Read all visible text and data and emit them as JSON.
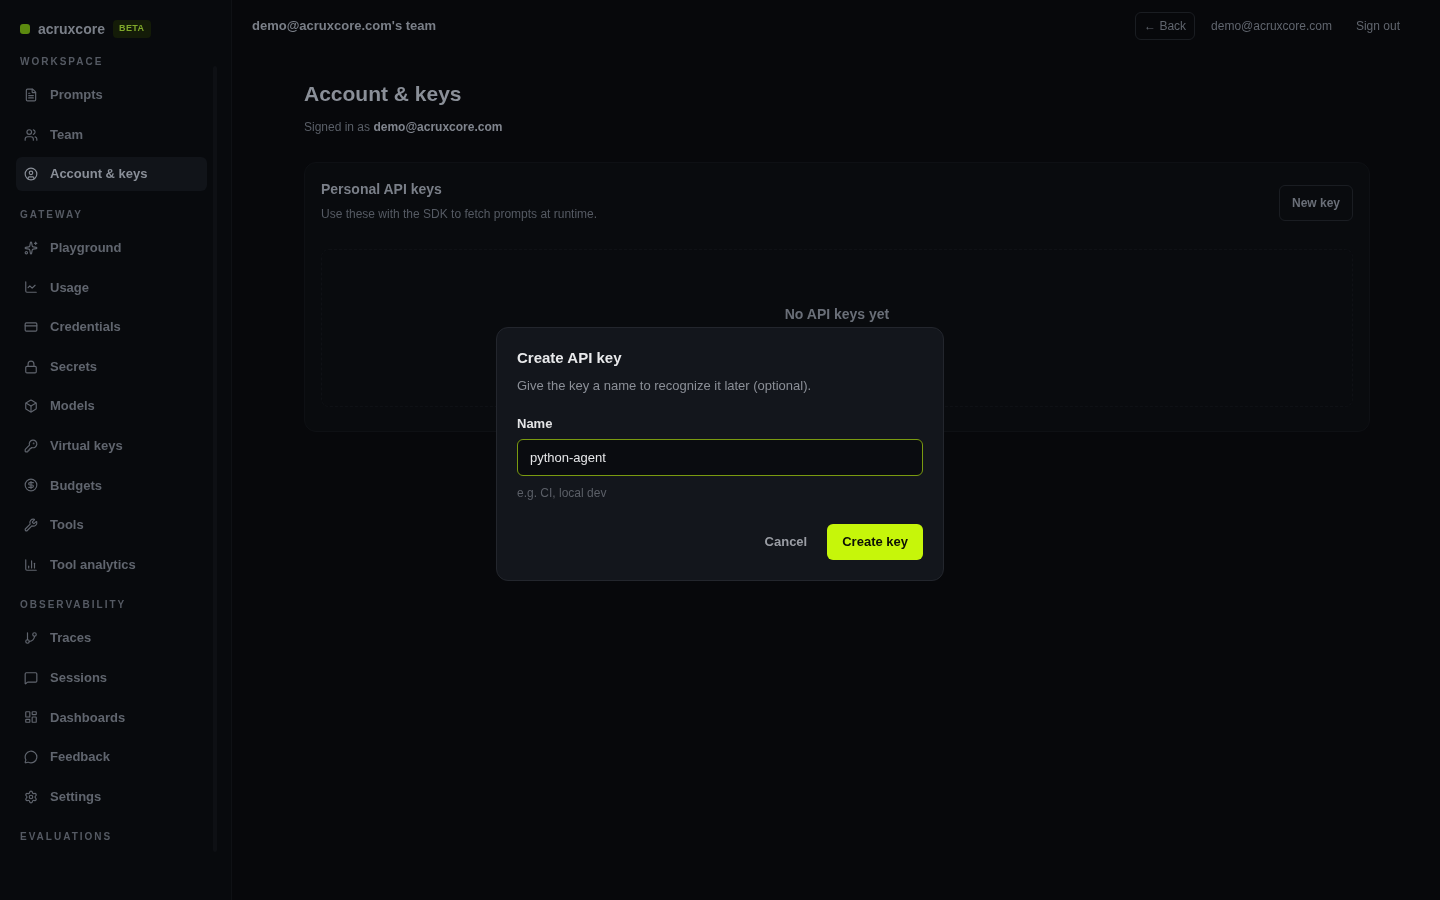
{
  "sidebar": {
    "brand": "acruxcore",
    "badge": "BETA",
    "sections": [
      {
        "title": "WORKSPACE",
        "items": [
          {
            "label": "Prompts",
            "selected": false
          },
          {
            "label": "Team",
            "selected": false
          },
          {
            "label": "Account & keys",
            "selected": true
          }
        ]
      },
      {
        "title": "GATEWAY",
        "items": [
          {
            "label": "Playground",
            "selected": false
          },
          {
            "label": "Usage",
            "selected": false
          },
          {
            "label": "Credentials",
            "selected": false
          },
          {
            "label": "Secrets",
            "selected": false
          },
          {
            "label": "Models",
            "selected": false
          },
          {
            "label": "Virtual keys",
            "selected": false
          },
          {
            "label": "Budgets",
            "selected": false
          },
          {
            "label": "Tools",
            "selected": false
          },
          {
            "label": "Tool analytics",
            "selected": false
          }
        ]
      },
      {
        "title": "OBSERVABILITY",
        "items": [
          {
            "label": "Traces",
            "selected": false
          },
          {
            "label": "Sessions",
            "selected": false
          },
          {
            "label": "Dashboards",
            "selected": false
          },
          {
            "label": "Feedback",
            "selected": false
          },
          {
            "label": "Settings",
            "selected": false
          }
        ]
      },
      {
        "title": "EVALUATIONS"
      }
    ]
  },
  "header": {
    "team": "demo@acruxcore.com's team",
    "back": "← Back",
    "email": "demo@acruxcore.com",
    "sign_out": "Sign out"
  },
  "page": {
    "title": "Account & keys",
    "subtitle": "Signed in as **demo@acruxcore.com**"
  },
  "card": {
    "title": "Personal API keys",
    "description": "Use these with the SDK to fetch prompts at runtime.",
    "button": "New key",
    "empty": "No API keys yet"
  },
  "dialog": {
    "title": "Create API key",
    "description": "Give the key a name to recognize it later (optional).",
    "field_label": "Name",
    "value": "python-agent",
    "hint": "e.g. CI, local dev",
    "cancel": "Cancel",
    "confirm": "Create key"
  }
}
